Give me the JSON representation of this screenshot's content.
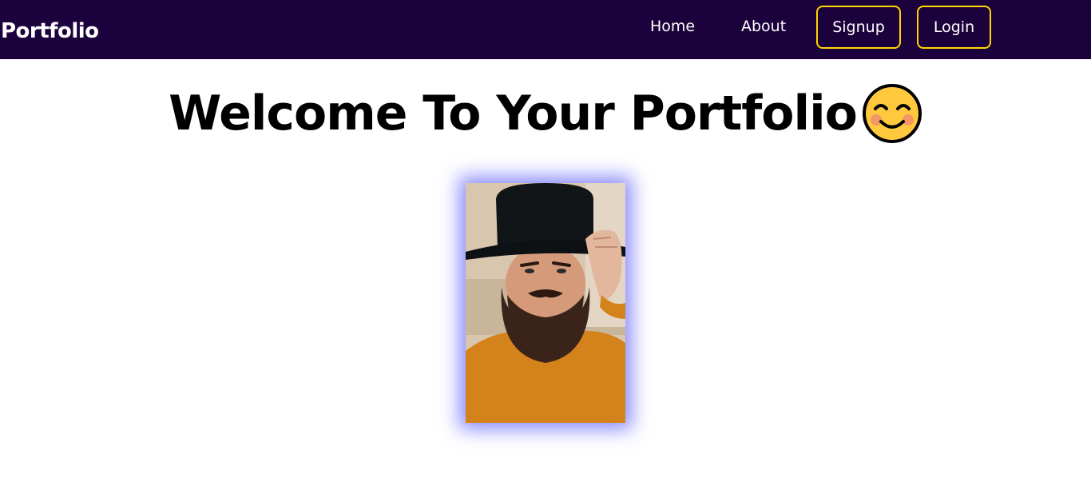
{
  "navbar": {
    "brand": "Portfolio",
    "links": [
      {
        "label": "Home"
      },
      {
        "label": "About"
      }
    ],
    "buttons": {
      "signup": "Signup",
      "login": "Login"
    },
    "colors": {
      "background": "#1c023d",
      "button_border": "#ffd600",
      "text": "#ffffff"
    }
  },
  "main": {
    "headline": "Welcome To Your Portfolio",
    "headline_emoji": "smiling-face-icon",
    "photo": {
      "subject": "portrait-photo",
      "glow_color": "#6464ff"
    }
  }
}
